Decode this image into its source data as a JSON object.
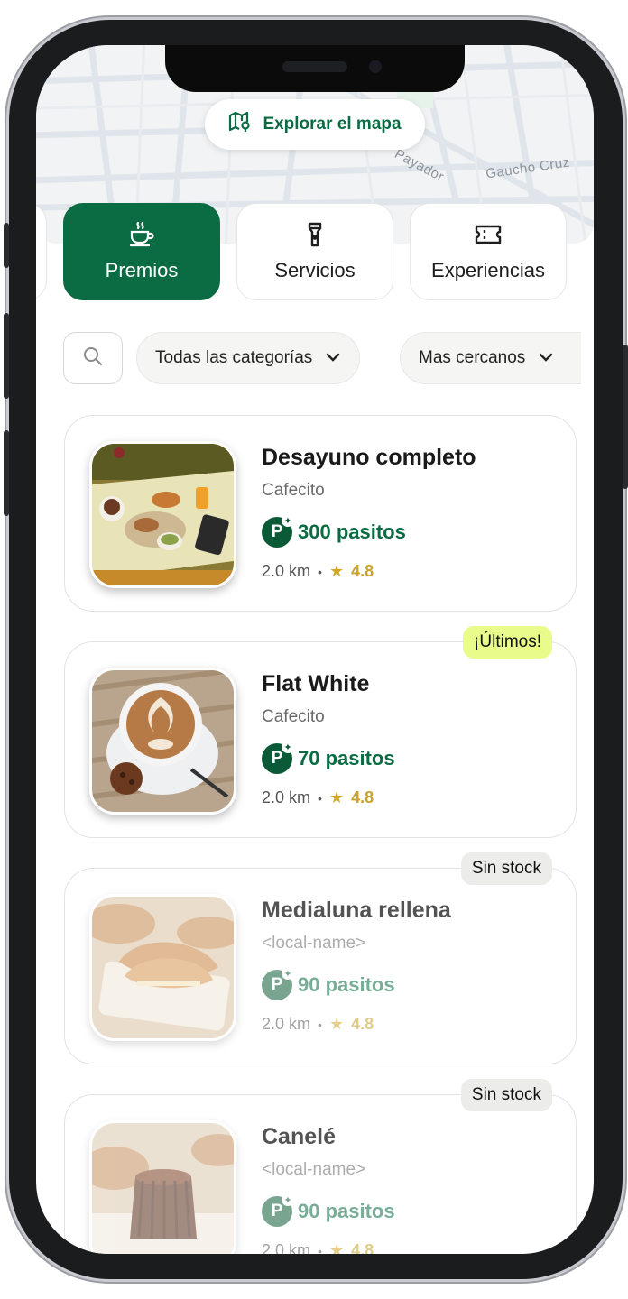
{
  "map": {
    "button_label": "Explorar el mapa",
    "street_labels": [
      "Payador",
      "Gaucho Cruz"
    ]
  },
  "tabs": [
    {
      "label": "Premios",
      "icon": "coffee-cup-icon",
      "active": true
    },
    {
      "label": "Servicios",
      "icon": "flashlight-icon",
      "active": false
    },
    {
      "label": "Experiencias",
      "icon": "ticket-icon",
      "active": false
    }
  ],
  "filters": {
    "category": "Todas las categorías",
    "sort": "Mas cercanos"
  },
  "items": [
    {
      "title": "Desayuno completo",
      "place": "Cafecito",
      "points": "300 pasitos",
      "distance": "2.0 km",
      "rating": "4.8",
      "badge": "",
      "available": true
    },
    {
      "title": "Flat White",
      "place": "Cafecito",
      "points": "70 pasitos",
      "distance": "2.0 km",
      "rating": "4.8",
      "badge": "¡Últimos!",
      "available": true
    },
    {
      "title": "Medialuna rellena",
      "place": "<local-name>",
      "points": "90 pasitos",
      "distance": "2.0 km",
      "rating": "4.8",
      "badge": "Sin stock",
      "available": false
    },
    {
      "title": "Canelé",
      "place": "<local-name>",
      "points": "90 pasitos",
      "distance": "2.0 km",
      "rating": "4.8",
      "badge": "Sin stock",
      "available": false
    }
  ],
  "points_badge_letter": "P",
  "colors": {
    "brand_green": "#0b6b43",
    "badge_latest": "#e9fb8a",
    "badge_out": "#ececea",
    "rating_gold": "#d4a92a"
  }
}
